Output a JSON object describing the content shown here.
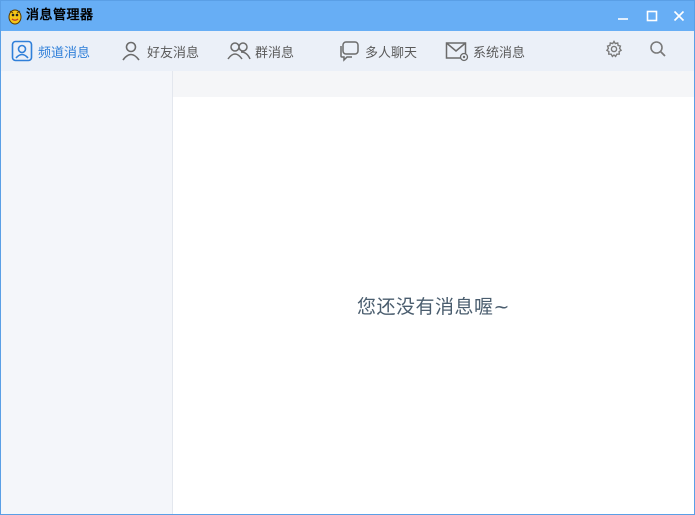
{
  "window": {
    "title": "消息管理器",
    "titlebar_color": "#67aef5",
    "minimize_icon": "minimize-icon",
    "maximize_icon": "maximize-icon",
    "close_icon": "close-icon"
  },
  "tabs": [
    {
      "label": "频道消息",
      "icon": "channel-user-icon",
      "active": true
    },
    {
      "label": "好友消息",
      "icon": "friend-icon",
      "active": false
    },
    {
      "label": "群消息",
      "icon": "group-icon",
      "active": false
    },
    {
      "label": "多人聊天",
      "icon": "multi-chat-icon",
      "active": false
    },
    {
      "label": "系统消息",
      "icon": "system-mail-icon",
      "active": false
    }
  ],
  "toolbar": {
    "settings_icon": "gear-icon",
    "search_icon": "search-icon"
  },
  "content": {
    "empty_message": "您还没有消息喔~"
  },
  "colors": {
    "accent": "#2f7fd9",
    "tabbar_bg": "#ebf0f8",
    "sidebar_bg": "#f4f6fa"
  }
}
